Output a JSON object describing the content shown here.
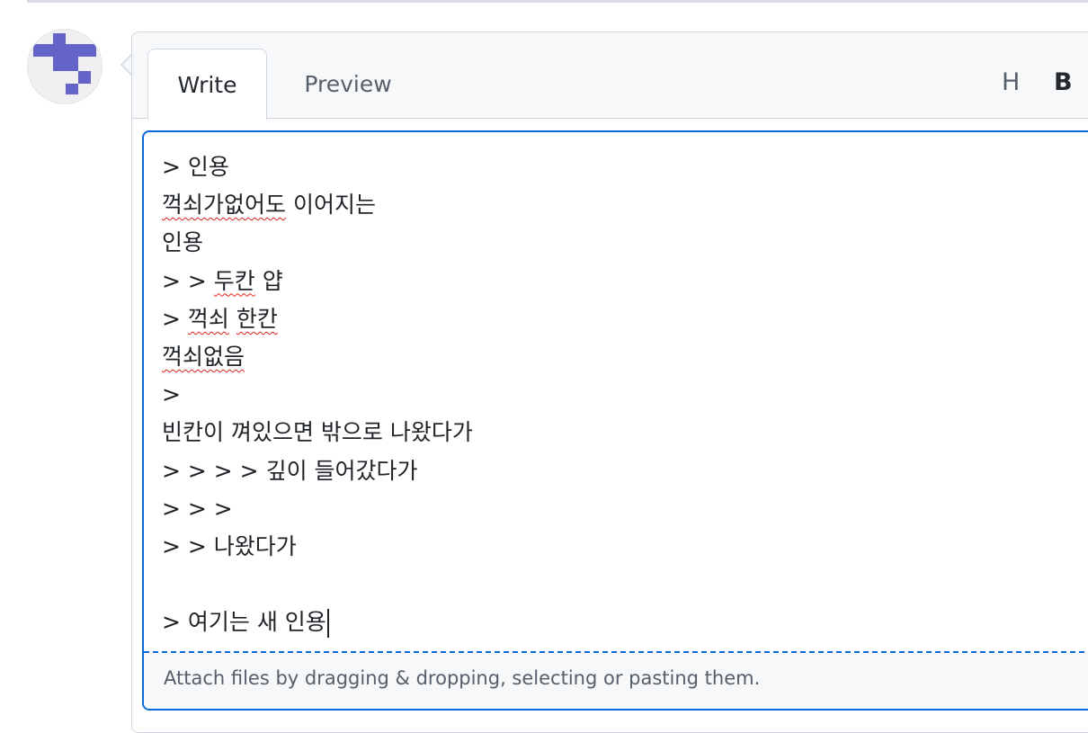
{
  "tabs": {
    "write": "Write",
    "preview": "Preview"
  },
  "toolbar": {
    "heading": "H",
    "bold": "B"
  },
  "editor_lines": [
    {
      "segments": [
        {
          "text": "> 인용",
          "sq": false
        }
      ]
    },
    {
      "segments": [
        {
          "text": "꺽쇠가없어도",
          "sq": true
        },
        {
          "text": " 이어지는",
          "sq": false
        }
      ]
    },
    {
      "segments": [
        {
          "text": "인용",
          "sq": false
        }
      ]
    },
    {
      "segments": [
        {
          "text": "> > ",
          "sq": false
        },
        {
          "text": "두칸",
          "sq": true
        },
        {
          "text": " 얍",
          "sq": false
        }
      ]
    },
    {
      "segments": [
        {
          "text": "> ",
          "sq": false
        },
        {
          "text": "꺽쇠",
          "sq": true
        },
        {
          "text": " ",
          "sq": false
        },
        {
          "text": "한칸",
          "sq": true
        }
      ]
    },
    {
      "segments": [
        {
          "text": "꺽쇠없음",
          "sq": true
        }
      ]
    },
    {
      "segments": [
        {
          "text": ">",
          "sq": false
        }
      ]
    },
    {
      "segments": [
        {
          "text": "빈칸이 껴있으면 밖으로 나왔다가",
          "sq": false
        }
      ]
    },
    {
      "segments": [
        {
          "text": "> > > > 깊이 들어갔다가",
          "sq": false
        }
      ]
    },
    {
      "segments": [
        {
          "text": "> > >",
          "sq": false
        }
      ]
    },
    {
      "segments": [
        {
          "text": "> > 나왔다가",
          "sq": false
        }
      ]
    },
    {
      "segments": [
        {
          "text": "",
          "sq": false
        }
      ]
    },
    {
      "segments": [
        {
          "text": "> 여기는 새 인용",
          "sq": false
        }
      ],
      "caret": true
    }
  ],
  "dropzone": {
    "text": "Attach files by dragging & dropping, selecting or pasting them."
  },
  "icons": {
    "avatar": "identicon-avatar",
    "avatar_color": "#6363c8"
  }
}
